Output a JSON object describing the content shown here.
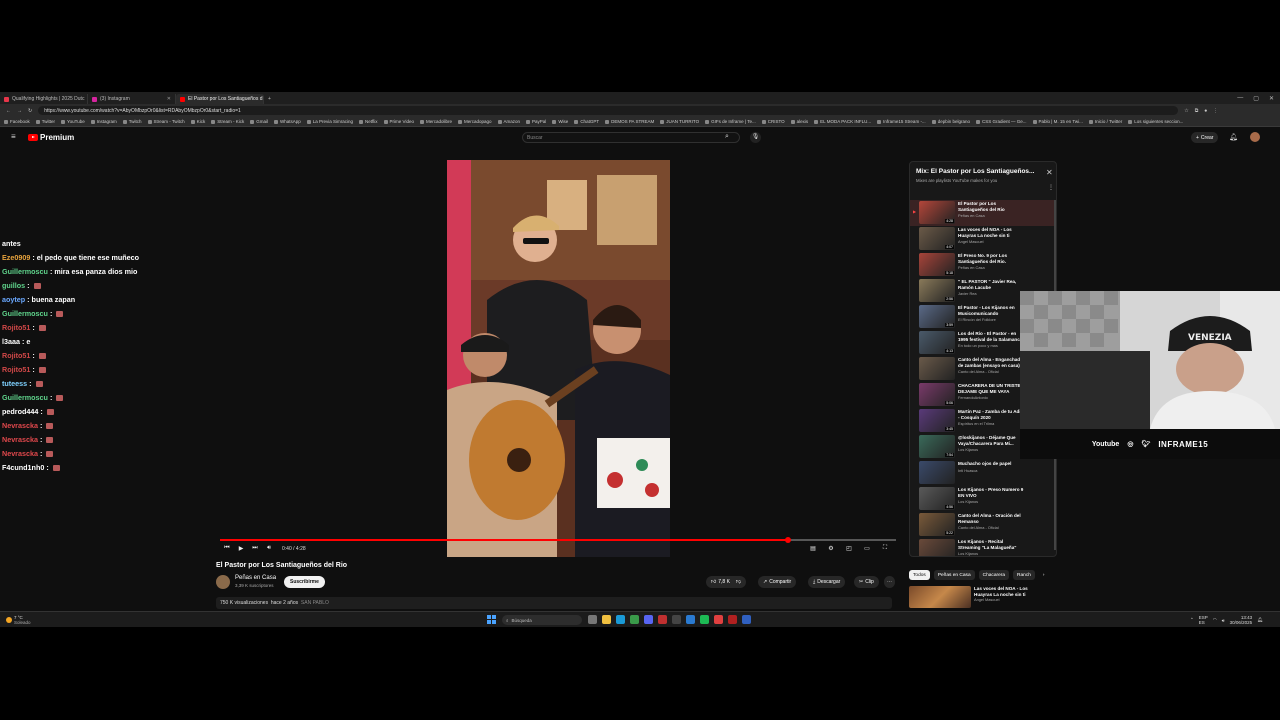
{
  "browser": {
    "tabs": [
      {
        "label": "Qualifying Highlights | 2025 Dutc",
        "color": "#e8364a"
      },
      {
        "label": "(3) Instagram",
        "color": "#d6249f"
      },
      {
        "label": "El Pastor por Los Santiagueños d",
        "color": "#ff0000"
      }
    ],
    "url": "https://www.youtube.com/watch?v=AbyOMbzpOr0&list=RDAbyOMbzpOr0&start_radio=1",
    "bookmarks": [
      "Facebook",
      "Twitter",
      "YouTube",
      "Instagram",
      "Twitch",
      "Stream - Twitch",
      "Kick",
      "Stream - Kick",
      "Gmail",
      "WhatsApp",
      "La Previa Simracing",
      "Netflix",
      "Prime Video",
      "Mercadolibre",
      "Mercadopago",
      "Amazon",
      "PayPal",
      "Wise",
      "ChatGPT",
      "DEMOS PA STREAM",
      "JUAN TURRITO",
      "GIFs de Inframe | Te...",
      "CRISTO",
      "alexis",
      "EL MODA PACK INFLU...",
      "Inframe15 Stream -...",
      "depbin belgrano",
      "CSS Gradient — Ge...",
      "Pablo | M. 15 en Twi...",
      "Inicio / Twitter",
      "Los siguientes seccion..."
    ]
  },
  "youtube": {
    "logo_text": "Premium",
    "search_placeholder": "Buscar",
    "create_label": "Crear"
  },
  "chat": [
    {
      "user": "antes",
      "text": "",
      "color": "#ffffff",
      "emote": false
    },
    {
      "user": "Eze0909",
      "text": ": el pedo que tiene ese muñeco",
      "color": "#e8a33d",
      "emote": false
    },
    {
      "user": "Guillermoscu",
      "text": ": mira esa panza dios mio",
      "color": "#5fd38b",
      "emote": false
    },
    {
      "user": "guillos",
      "text": ":",
      "color": "#5fd38b",
      "emote": true
    },
    {
      "user": "aoytep",
      "text": ": buena zapan",
      "color": "#6aa8ff",
      "emote": false
    },
    {
      "user": "Guillermoscu",
      "text": ":",
      "color": "#5fd38b",
      "emote": true
    },
    {
      "user": "Rojito51",
      "text": ":",
      "color": "#d14848",
      "emote": true
    },
    {
      "user": "l3aaa",
      "text": ": e",
      "color": "#ffffff",
      "emote": false
    },
    {
      "user": "Rojito51",
      "text": ":",
      "color": "#d14848",
      "emote": true
    },
    {
      "user": "Rojito51",
      "text": ":",
      "color": "#d14848",
      "emote": true
    },
    {
      "user": "tuteess",
      "text": ":",
      "color": "#7fd1ff",
      "emote": true
    },
    {
      "user": "Guillermoscu",
      "text": ":",
      "color": "#5fd38b",
      "emote": true
    },
    {
      "user": "pedrod444",
      "text": ":",
      "color": "#ffffff",
      "emote": true
    },
    {
      "user": "Nevrascka",
      "text": ":",
      "color": "#e0484c",
      "emote": true
    },
    {
      "user": "Nevrascka",
      "text": ":",
      "color": "#e0484c",
      "emote": true
    },
    {
      "user": "Nevrascka",
      "text": ":",
      "color": "#e0484c",
      "emote": true
    },
    {
      "user": "F4cund1nh0",
      "text": ":",
      "color": "#ffffff",
      "emote": true
    }
  ],
  "player": {
    "timecode": "0:40 / 4:28",
    "progress": 0.84
  },
  "video": {
    "title": "El Pastor por Los Santiagueños del Rio",
    "channel": "Peñas en Casa",
    "subscribers": "3,39 K suscriptores",
    "subscribe_label": "Suscribirme",
    "likes": "7,8 K",
    "share_label": "Compartir",
    "download_label": "Descargar",
    "clip_label": "Clip",
    "views": "750 K visualizaciones",
    "age": "hace 2 años",
    "location": "SAN PABLO"
  },
  "playlist": {
    "title": "Mix: El Pastor por Los Santiagueños...",
    "subtitle": "Mixes are playlists YouTube makes for you",
    "items": [
      {
        "title": "El Pastor por Los Santiagueños del Rio",
        "channel": "Peñas en Casa",
        "duration": "4:28",
        "color": "#b4463a"
      },
      {
        "title": "Las voces del NOA - Los Huayras La noche sin ti",
        "channel": "Angel Mascuel",
        "duration": "4:07",
        "color": "#6b5a48"
      },
      {
        "title": "El Preso No. 9 por Los Santiagueños del Rio.",
        "channel": "Peñas en Casa",
        "duration": "5:18",
        "color": "#a8443a"
      },
      {
        "title": "\" EL PASTOR \" Javier Rea, Ramón Lacube",
        "channel": "Javier Rea",
        "duration": "2:56",
        "color": "#8a7a5a"
      },
      {
        "title": "El Pastor - Los Kijanos en Musicomunicando",
        "channel": "El Rincón del Folklore",
        "duration": "3:59",
        "color": "#5a6a88"
      },
      {
        "title": "Los del Río - El Pastor - en 1995 festival de la Salamanca",
        "channel": "En todo un poco y mas",
        "duration": "4:13",
        "color": "#4a5a6a"
      },
      {
        "title": "Canto del Alma - Enganchado de zambas (ensayo en casa)",
        "channel": "Canto del Alma - Oficial",
        "duration": "",
        "color": "#6a5a4a"
      },
      {
        "title": "CHACARERA DE UN TRISTE - DEJAME QUE ME VAYA",
        "channel": "FernandoAntonio",
        "duration": "5:06",
        "color": "#7a3a6a"
      },
      {
        "title": "Martin Paz - Zamba de tu Adiós - Cosquín 2020",
        "channel": "Espíritus en el Trilma",
        "duration": "3:45",
        "color": "#5a3a7a"
      },
      {
        "title": "@loskijanos - Déjame Que Vaya/Chacarera Para Mi...",
        "channel": "Los Kijanos",
        "duration": "7:54",
        "color": "#3a6a5a"
      },
      {
        "title": "Muchacho ojos de papel",
        "channel": "Inti Huasca",
        "duration": "",
        "color": "#3a4a6a"
      },
      {
        "title": "Los Kijanos - Preso Numero 9 EN VIVO",
        "channel": "Los Kijanos",
        "duration": "4:56",
        "color": "#5a5a5a"
      },
      {
        "title": "Canto del Alma - Oración del Remanso",
        "channel": "Canto del Alma - Oficial",
        "duration": "5:22",
        "color": "#7a5a3a"
      },
      {
        "title": "Los Kijanos - Recital Streaming \"La Malagueña\"",
        "channel": "Los Kijanos",
        "duration": "5:35",
        "color": "#6a4a3a"
      }
    ]
  },
  "webcam": {
    "platform_label": "Youtube",
    "brand": "INFRAME15"
  },
  "chips": [
    "Todos",
    "Peñas en Casa",
    "Chacarera",
    "Ranch"
  ],
  "next_item": {
    "title": "Las voces del NOA - Los Huayras La noche sin ti",
    "channel": "Angel Mascuel"
  },
  "taskbar": {
    "weather_temp": "7 °C",
    "weather_desc": "Soleado",
    "search_placeholder": "Búsqueda",
    "lang": "ESP",
    "region": "ES",
    "time": "13:43",
    "date": "30/06/2025"
  }
}
